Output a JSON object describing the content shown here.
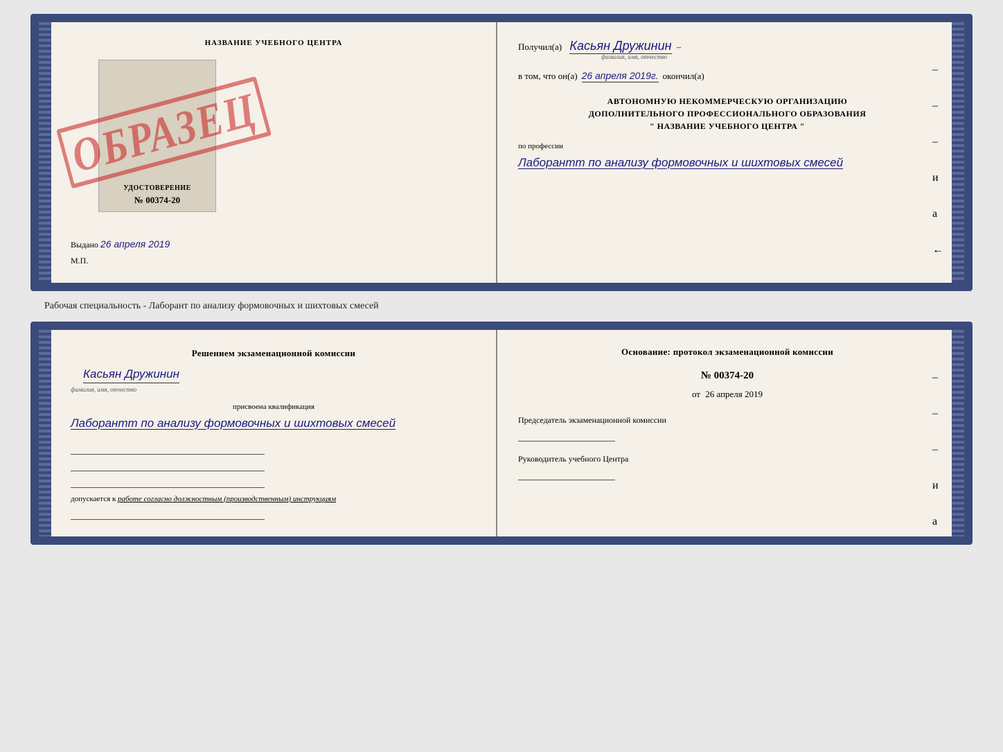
{
  "top_document": {
    "left": {
      "title": "НАЗВАНИЕ УЧЕБНОГО ЦЕНТРА",
      "cert_label": "УДОСТОВЕРЕНИЕ",
      "cert_number": "№ 00374-20",
      "stamp": "ОБРАЗЕЦ",
      "vydano_prefix": "Выдано",
      "vydano_date": "26 апреля 2019",
      "mp": "М.П."
    },
    "right": {
      "poluchil_prefix": "Получил(а)",
      "poluchil_name": "Касьян Дружинин",
      "poluchil_subtext": "фамилия, имя, отчество",
      "vtom_prefix": "в том, что он(а)",
      "vtom_date": "26 апреля 2019г.",
      "okoncil": "окончил(а)",
      "org_line1": "АВТОНОМНУЮ НЕКОММЕРЧЕСКУЮ ОРГАНИЗАЦИЮ",
      "org_line2": "ДОПОЛНИТЕЛЬНОГО ПРОФЕССИОНАЛЬНОГО ОБРАЗОВАНИЯ",
      "org_line3": "\"   НАЗВАНИЕ УЧЕБНОГО ЦЕНТРА   \"",
      "po_professii_label": "по профессии",
      "profession": "Лаборантт по анализу формовочных и шихтовых смесей",
      "dashes": [
        "–",
        "–",
        "–",
        "и",
        "а",
        "←",
        "–",
        "–"
      ]
    }
  },
  "specialty_label": "Рабочая специальность - Лаборант по анализу формовочных и шихтовых смесей",
  "bottom_document": {
    "left": {
      "komissia_title": "Решением экзаменационной комиссии",
      "name": "Касьян Дружинин",
      "name_subtext": "фамилия, имя, отчество",
      "prisvoena_label": "присвоена квалификация",
      "prisvoena_profession": "Лаборантт по анализу формовочных и шихтовых смесей",
      "dopuskaetsya_prefix": "допускается к",
      "dopuskaetsya_text": "работе согласно должностным (производственным) инструкциям"
    },
    "right": {
      "osnovanie_title": "Основание: протокол экзаменационной комиссии",
      "protocol_number": "№ 00374-20",
      "ot_prefix": "от",
      "ot_date": "26 апреля 2019",
      "predsedatel_label": "Председатель экзаменационной комиссии",
      "rukovoditel_label": "Руководитель учебного Центра",
      "dashes": [
        "–",
        "–",
        "–",
        "и",
        "а",
        "←",
        "–",
        "–"
      ]
    }
  }
}
